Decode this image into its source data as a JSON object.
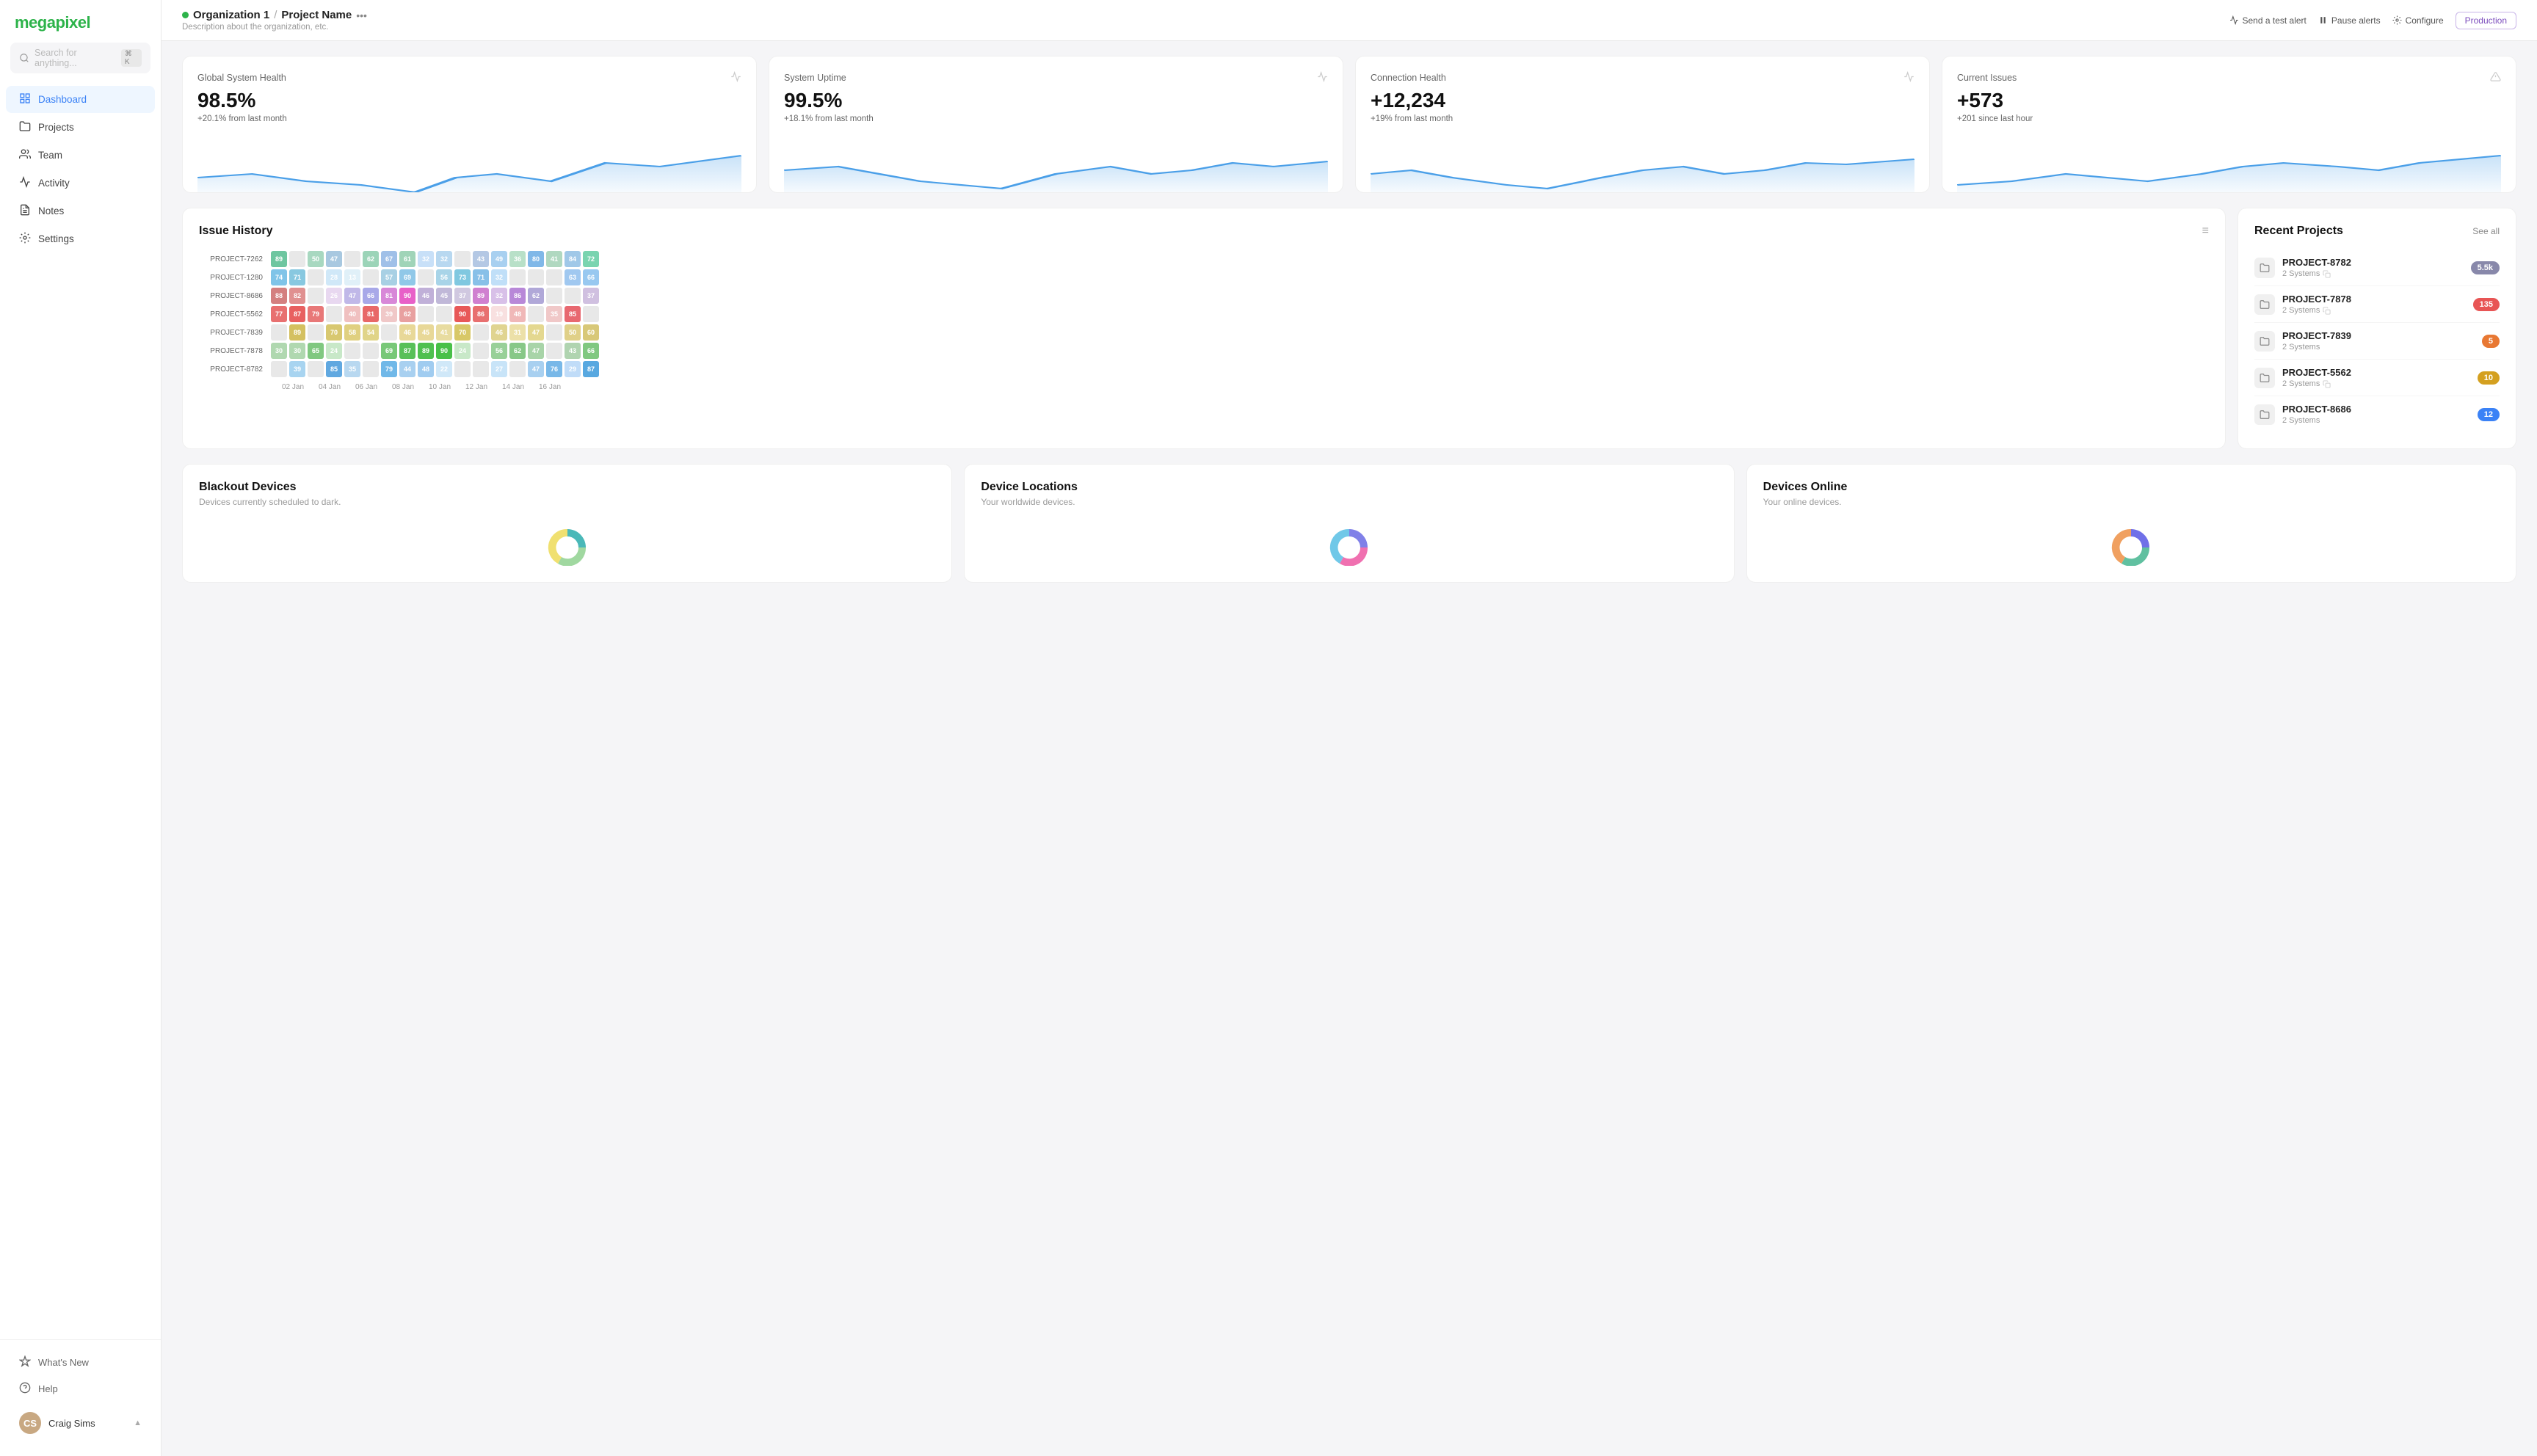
{
  "app": {
    "logo": "megapixel"
  },
  "sidebar": {
    "search_placeholder": "Search for anything...",
    "search_shortcut": "⌘ K",
    "nav_items": [
      {
        "id": "dashboard",
        "label": "Dashboard",
        "icon": "grid",
        "active": true
      },
      {
        "id": "projects",
        "label": "Projects",
        "icon": "folder",
        "active": false
      },
      {
        "id": "team",
        "label": "Team",
        "icon": "users",
        "active": false
      },
      {
        "id": "activity",
        "label": "Activity",
        "icon": "activity",
        "active": false
      },
      {
        "id": "notes",
        "label": "Notes",
        "icon": "file-text",
        "active": false
      },
      {
        "id": "settings",
        "label": "Settings",
        "icon": "settings",
        "active": false
      }
    ],
    "bottom_items": [
      {
        "id": "help",
        "label": "Help",
        "icon": "help-circle"
      },
      {
        "id": "whats-new",
        "label": "What's New",
        "icon": "sparkle"
      }
    ],
    "user": {
      "name": "Craig Sims",
      "avatar_initials": "CS"
    }
  },
  "header": {
    "org_name": "Organization 1",
    "project_name": "Project Name",
    "description": "Description about the organization, etc.",
    "actions": [
      {
        "id": "send-test",
        "label": "Send a test alert",
        "icon": "alert"
      },
      {
        "id": "pause-alerts",
        "label": "Pause alerts",
        "icon": "pause"
      },
      {
        "id": "configure",
        "label": "Configure",
        "icon": "gear"
      }
    ],
    "environment_badge": "Production"
  },
  "metrics": [
    {
      "id": "global-health",
      "label": "Global System Health",
      "value": "98.5%",
      "change": "+20.1% from last month",
      "icon": "pulse"
    },
    {
      "id": "system-uptime",
      "label": "System Uptime",
      "value": "99.5%",
      "change": "+18.1% from last month",
      "icon": "pulse"
    },
    {
      "id": "connection-health",
      "label": "Connection Health",
      "value": "+12,234",
      "change": "+19% from last month",
      "icon": "pulse"
    },
    {
      "id": "current-issues",
      "label": "Current Issues",
      "value": "+573",
      "change": "+201 since last hour",
      "icon": "warning"
    }
  ],
  "issue_history": {
    "title": "Issue History",
    "x_labels": [
      "02 Jan",
      "04 Jan",
      "06 Jan",
      "08 Jan",
      "10 Jan",
      "12 Jan",
      "14 Jan",
      "16 Jan"
    ],
    "rows": [
      {
        "label": "PROJECT-7262",
        "cells": [
          {
            "v": "89",
            "c": "#6ec6a0"
          },
          {
            "v": "",
            "c": "#e8e8e8"
          },
          {
            "v": "50",
            "c": "#a8d8c0"
          },
          {
            "v": "47",
            "c": "#a8c8e0"
          },
          {
            "v": "",
            "c": "#e8e8e8"
          },
          {
            "v": "62",
            "c": "#9cd4b8"
          },
          {
            "v": "67",
            "c": "#a0c0e8"
          },
          {
            "v": "61",
            "c": "#a0d4b8"
          },
          {
            "v": "32",
            "c": "#c8e0f8"
          },
          {
            "v": "32",
            "c": "#b8d8f0"
          },
          {
            "v": "",
            "c": "#e8e8e8"
          },
          {
            "v": "43",
            "c": "#b4c8e4"
          },
          {
            "v": "49",
            "c": "#a8d0f0"
          },
          {
            "v": "36",
            "c": "#b8e0c8"
          },
          {
            "v": "80",
            "c": "#80b8e8"
          },
          {
            "v": "41",
            "c": "#b0d8c0"
          },
          {
            "v": "84",
            "c": "#a0c8e8"
          },
          {
            "v": "72",
            "c": "#7ad4b0"
          }
        ]
      },
      {
        "label": "PROJECT-1280",
        "cells": [
          {
            "v": "74",
            "c": "#80c4e8"
          },
          {
            "v": "71",
            "c": "#88c8e0"
          },
          {
            "v": "",
            "c": "#e8e8e8"
          },
          {
            "v": "28",
            "c": "#d0e8f8"
          },
          {
            "v": "13",
            "c": "#e0f0f8"
          },
          {
            "v": "",
            "c": "#e8e8e8"
          },
          {
            "v": "57",
            "c": "#a8d0e4"
          },
          {
            "v": "69",
            "c": "#90c8e8"
          },
          {
            "v": "",
            "c": "#e8e8e8"
          },
          {
            "v": "56",
            "c": "#a8d4e8"
          },
          {
            "v": "73",
            "c": "#80c8e0"
          },
          {
            "v": "71",
            "c": "#88c0e8"
          },
          {
            "v": "32",
            "c": "#c0dff8"
          },
          {
            "v": "",
            "c": "#e8e8e8"
          },
          {
            "v": "",
            "c": "#e8e8e8"
          },
          {
            "v": "",
            "c": "#e8e8e8"
          },
          {
            "v": "63",
            "c": "#a0c8f0"
          },
          {
            "v": "66",
            "c": "#98c8f0"
          }
        ]
      },
      {
        "label": "PROJECT-8686",
        "cells": [
          {
            "v": "88",
            "c": "#d48080"
          },
          {
            "v": "82",
            "c": "#e09090"
          },
          {
            "v": "",
            "c": "#e8e8e8"
          },
          {
            "v": "26",
            "c": "#e8d8f0"
          },
          {
            "v": "47",
            "c": "#c0b8e8"
          },
          {
            "v": "66",
            "c": "#a8a8e8"
          },
          {
            "v": "81",
            "c": "#d888d8"
          },
          {
            "v": "90",
            "c": "#e860c8"
          },
          {
            "v": "46",
            "c": "#c0b0d8"
          },
          {
            "v": "45",
            "c": "#c0b8d8"
          },
          {
            "v": "37",
            "c": "#d0c8e0"
          },
          {
            "v": "89",
            "c": "#d080d0"
          },
          {
            "v": "32",
            "c": "#d8c0e8"
          },
          {
            "v": "86",
            "c": "#b888d8"
          },
          {
            "v": "62",
            "c": "#b0a8d8"
          },
          {
            "v": "",
            "c": "#e8e8e8"
          },
          {
            "v": "",
            "c": "#e8e8e8"
          },
          {
            "v": "37",
            "c": "#d0c0e0"
          }
        ]
      },
      {
        "label": "PROJECT-5562",
        "cells": [
          {
            "v": "77",
            "c": "#e87070"
          },
          {
            "v": "87",
            "c": "#e86060"
          },
          {
            "v": "79",
            "c": "#e87878"
          },
          {
            "v": "",
            "c": "#e8e8e8"
          },
          {
            "v": "40",
            "c": "#f0c0c0"
          },
          {
            "v": "81",
            "c": "#e86868"
          },
          {
            "v": "39",
            "c": "#f0c8c8"
          },
          {
            "v": "62",
            "c": "#e8a0a0"
          },
          {
            "v": "",
            "c": "#e8e8e8"
          },
          {
            "v": "",
            "c": "#e8e8e8"
          },
          {
            "v": "90",
            "c": "#e85858"
          },
          {
            "v": "86",
            "c": "#e87070"
          },
          {
            "v": "19",
            "c": "#f8e0e0"
          },
          {
            "v": "48",
            "c": "#f0b8b8"
          },
          {
            "v": "",
            "c": "#e8e8e8"
          },
          {
            "v": "35",
            "c": "#f0c8c8"
          },
          {
            "v": "85",
            "c": "#e86870"
          },
          {
            "v": "",
            "c": "#e8e8e8"
          }
        ]
      },
      {
        "label": "PROJECT-7839",
        "cells": [
          {
            "v": "",
            "c": "#e8e8e8"
          },
          {
            "v": "89",
            "c": "#d4c060"
          },
          {
            "v": "",
            "c": "#e8e8e8"
          },
          {
            "v": "70",
            "c": "#d8c870"
          },
          {
            "v": "58",
            "c": "#e0d080"
          },
          {
            "v": "54",
            "c": "#e0d488"
          },
          {
            "v": "",
            "c": "#e8e8e8"
          },
          {
            "v": "46",
            "c": "#e8d898"
          },
          {
            "v": "45",
            "c": "#e8d898"
          },
          {
            "v": "41",
            "c": "#e8dca0"
          },
          {
            "v": "70",
            "c": "#d8c868"
          },
          {
            "v": "",
            "c": "#e8e8e8"
          },
          {
            "v": "46",
            "c": "#e0d490"
          },
          {
            "v": "31",
            "c": "#ece0a8"
          },
          {
            "v": "47",
            "c": "#e4d890"
          },
          {
            "v": "",
            "c": "#e8e8e8"
          },
          {
            "v": "50",
            "c": "#e0d088"
          },
          {
            "v": "60",
            "c": "#d8c878"
          }
        ]
      },
      {
        "label": "PROJECT-7878",
        "cells": [
          {
            "v": "30",
            "c": "#b0d8b0"
          },
          {
            "v": "30",
            "c": "#b0d8b0"
          },
          {
            "v": "65",
            "c": "#80c880"
          },
          {
            "v": "24",
            "c": "#c8e8c8"
          },
          {
            "v": "",
            "c": "#e8e8e8"
          },
          {
            "v": "",
            "c": "#e8e8e8"
          },
          {
            "v": "69",
            "c": "#78c878"
          },
          {
            "v": "87",
            "c": "#58c058"
          },
          {
            "v": "89",
            "c": "#50c050"
          },
          {
            "v": "90",
            "c": "#48c048"
          },
          {
            "v": "24",
            "c": "#c8e8c8"
          },
          {
            "v": "",
            "c": "#e8e8e8"
          },
          {
            "v": "56",
            "c": "#98d098"
          },
          {
            "v": "62",
            "c": "#88c888"
          },
          {
            "v": "47",
            "c": "#a8d4a8"
          },
          {
            "v": "",
            "c": "#e8e8e8"
          },
          {
            "v": "43",
            "c": "#b0d4b0"
          },
          {
            "v": "66",
            "c": "#80c880"
          }
        ]
      },
      {
        "label": "PROJECT-8782",
        "cells": [
          {
            "v": "",
            "c": "#e8e8e8"
          },
          {
            "v": "39",
            "c": "#a8d4f0"
          },
          {
            "v": "",
            "c": "#e8e8e8"
          },
          {
            "v": "85",
            "c": "#60a8e0"
          },
          {
            "v": "35",
            "c": "#b8d8f0"
          },
          {
            "v": "",
            "c": "#e8e8e8"
          },
          {
            "v": "79",
            "c": "#70b8e8"
          },
          {
            "v": "44",
            "c": "#a8d0f0"
          },
          {
            "v": "48",
            "c": "#a0ccf0"
          },
          {
            "v": "22",
            "c": "#d0e8f8"
          },
          {
            "v": "",
            "c": "#e8e8e8"
          },
          {
            "v": "",
            "c": "#e8e8e8"
          },
          {
            "v": "27",
            "c": "#c8e4f8"
          },
          {
            "v": "",
            "c": "#e8e8e8"
          },
          {
            "v": "47",
            "c": "#a8d0f0"
          },
          {
            "v": "76",
            "c": "#78b8e8"
          },
          {
            "v": "29",
            "c": "#c0dcf8"
          },
          {
            "v": "87",
            "c": "#58a8e0"
          }
        ]
      }
    ]
  },
  "recent_projects": {
    "title": "Recent Projects",
    "see_all_label": "See all",
    "items": [
      {
        "name": "PROJECT-8782",
        "systems": "2 Systems",
        "has_copy": true,
        "badge_value": "5.5k",
        "badge_color": "#8888aa"
      },
      {
        "name": "PROJECT-7878",
        "systems": "2 Systems",
        "has_copy": true,
        "badge_value": "135",
        "badge_color": "#e85555"
      },
      {
        "name": "PROJECT-7839",
        "systems": "2 Systems",
        "has_copy": false,
        "badge_value": "5",
        "badge_color": "#e87833"
      },
      {
        "name": "PROJECT-5562",
        "systems": "2 Systems",
        "has_copy": true,
        "badge_value": "10",
        "badge_color": "#d4a020"
      },
      {
        "name": "PROJECT-8686",
        "systems": "2 Systems",
        "has_copy": false,
        "badge_value": "12",
        "badge_color": "#3b82f6"
      }
    ]
  },
  "bottom_cards": [
    {
      "id": "blackout-devices",
      "title": "Blackout Devices",
      "desc": "Devices currently scheduled to dark."
    },
    {
      "id": "device-locations",
      "title": "Device Locations",
      "desc": "Your worldwide devices."
    },
    {
      "id": "devices-online",
      "title": "Devices Online",
      "desc": "Your online devices."
    }
  ]
}
